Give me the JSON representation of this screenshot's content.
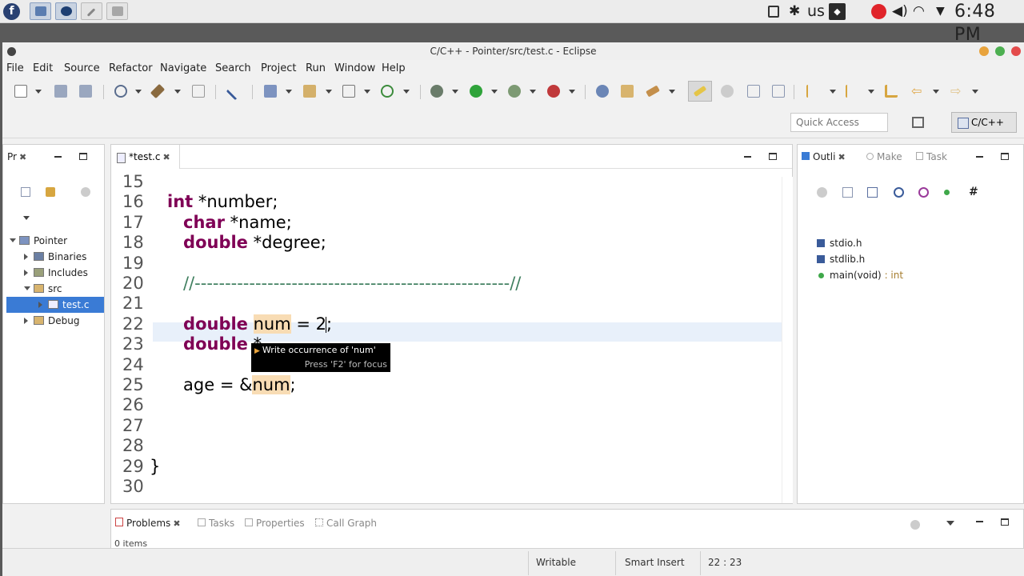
{
  "system": {
    "keyboard": "us",
    "clock": "6:48 PM"
  },
  "window": {
    "title": "C/C++ - Pointer/src/test.c - Eclipse",
    "button_colors": [
      "#e8a33c",
      "#4caf50",
      "#e34b4b"
    ]
  },
  "menu": [
    "File",
    "Edit",
    "Source",
    "Refactor",
    "Navigate",
    "Search",
    "Project",
    "Run",
    "Window",
    "Help"
  ],
  "toolbar": {
    "quick_access_placeholder": "Quick Access",
    "perspective": "C/C++"
  },
  "project_explorer": {
    "tab": "Pr",
    "tree": [
      {
        "label": "Pointer",
        "level": 0,
        "expanded": true,
        "icon": "project-folder-icon",
        "selected": false
      },
      {
        "label": "Binaries",
        "level": 1,
        "expanded": false,
        "icon": "binaries-icon",
        "selected": false
      },
      {
        "label": "Includes",
        "level": 1,
        "expanded": false,
        "icon": "includes-icon",
        "selected": false
      },
      {
        "label": "src",
        "level": 1,
        "expanded": true,
        "icon": "source-folder-icon",
        "selected": false
      },
      {
        "label": "test.c",
        "level": 2,
        "expanded": false,
        "icon": "c-file-icon",
        "selected": true
      },
      {
        "label": "Debug",
        "level": 1,
        "expanded": false,
        "icon": "folder-icon",
        "selected": false
      }
    ]
  },
  "editor": {
    "tab": "*test.c",
    "lines": [
      {
        "n": "15",
        "code": []
      },
      {
        "n": "16",
        "code": [
          {
            "t": "int",
            "k": "kw"
          },
          {
            "t": " *number;",
            "k": ""
          }
        ]
      },
      {
        "n": "17",
        "code": [
          {
            "t": "   ",
            "k": ""
          },
          {
            "t": "char",
            "k": "kw"
          },
          {
            "t": " *name;",
            "k": ""
          }
        ]
      },
      {
        "n": "18",
        "code": [
          {
            "t": "   ",
            "k": ""
          },
          {
            "t": "double",
            "k": "kw"
          },
          {
            "t": " *degree;",
            "k": ""
          }
        ]
      },
      {
        "n": "19",
        "code": []
      },
      {
        "n": "20",
        "code": [
          {
            "t": "   ",
            "k": ""
          },
          {
            "t": "//----------------------------------------------------//",
            "k": "cmt"
          }
        ]
      },
      {
        "n": "21",
        "code": []
      },
      {
        "n": "22",
        "code": [
          {
            "t": "   ",
            "k": ""
          },
          {
            "t": "double",
            "k": "kw"
          },
          {
            "t": " ",
            "k": ""
          },
          {
            "t": "num",
            "k": "hl"
          },
          {
            "t": " = 2;",
            "k": ""
          }
        ]
      },
      {
        "n": "23",
        "code": [
          {
            "t": "   ",
            "k": ""
          },
          {
            "t": "double",
            "k": "kw"
          },
          {
            "t": " *",
            "k": ""
          }
        ]
      },
      {
        "n": "24",
        "code": []
      },
      {
        "n": "25",
        "code": [
          {
            "t": "   age = &",
            "k": ""
          },
          {
            "t": "num",
            "k": "hl"
          },
          {
            "t": ";",
            "k": ""
          }
        ]
      },
      {
        "n": "26",
        "code": []
      },
      {
        "n": "27",
        "code": []
      },
      {
        "n": "28",
        "code": []
      },
      {
        "n": "29",
        "code": [
          {
            "t": "}",
            "k": ""
          }
        ]
      },
      {
        "n": "30",
        "code": []
      }
    ],
    "tooltip": {
      "title": "Write occurrence of 'num'",
      "hint": "Press 'F2' for focus"
    }
  },
  "outline": {
    "tabs": [
      "Outli",
      "Make",
      "Task"
    ],
    "items": [
      {
        "name": "stdio.h",
        "type": ""
      },
      {
        "name": "stdlib.h",
        "type": ""
      },
      {
        "name": "main(void)",
        "type": " : int"
      }
    ]
  },
  "bottom_panel": {
    "tabs": [
      "Problems",
      "Tasks",
      "Properties",
      "Call Graph"
    ],
    "count": "0 items"
  },
  "status": {
    "writable": "Writable",
    "insert_mode": "Smart Insert",
    "position": "22 : 23"
  }
}
